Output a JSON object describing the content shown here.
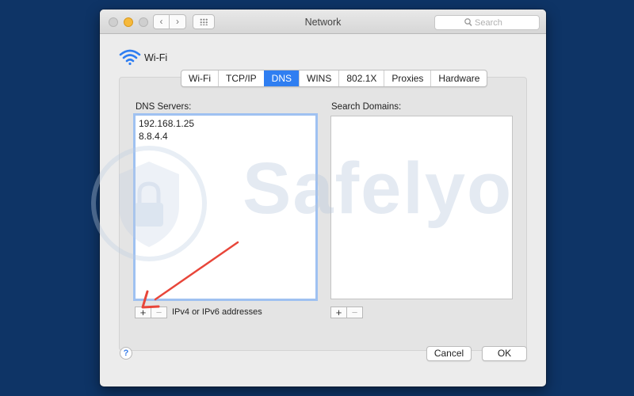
{
  "window": {
    "title": "Network"
  },
  "titlebar": {
    "search_placeholder": "Search"
  },
  "interface": {
    "name": "Wi-Fi"
  },
  "tabs": [
    {
      "label": "Wi-Fi"
    },
    {
      "label": "TCP/IP"
    },
    {
      "label": "DNS",
      "active": true
    },
    {
      "label": "WINS"
    },
    {
      "label": "802.1X"
    },
    {
      "label": "Proxies"
    },
    {
      "label": "Hardware"
    }
  ],
  "dns": {
    "label": "DNS Servers:",
    "servers": [
      "192.168.1.25",
      "8.8.4.4"
    ],
    "hint": "IPv4 or IPv6 addresses"
  },
  "search_domains": {
    "label": "Search Domains:",
    "entries": []
  },
  "controls": {
    "add": "+",
    "remove": "−"
  },
  "footer": {
    "help": "?",
    "cancel": "Cancel",
    "ok": "OK"
  },
  "watermark": {
    "text": "Safelyo"
  },
  "colors": {
    "accent": "#2f7ef1",
    "arrow": "#e8463a",
    "background": "#0e3466"
  }
}
